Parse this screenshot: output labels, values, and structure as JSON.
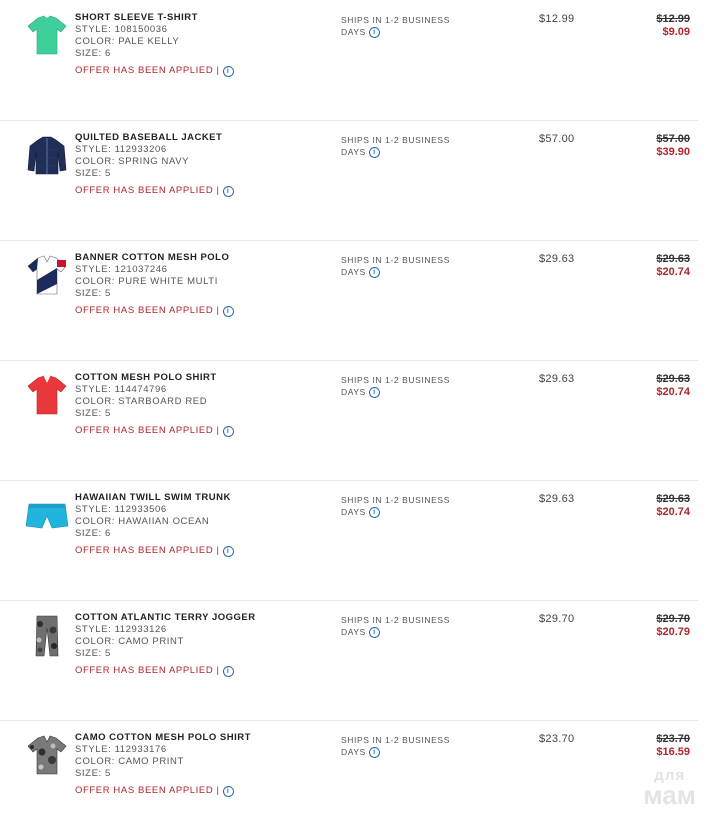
{
  "colors": {
    "accent_red": "#b0262b",
    "info_blue": "#2b6cb0",
    "divider": "#e6e6e6"
  },
  "items": [
    {
      "title": "SHORT SLEEVE T-SHIRT",
      "style": "STYLE:  108150036",
      "color": "COLOR:  PALE KELLY",
      "size": "SIZE:  6",
      "offer": "OFFER HAS BEEN APPLIED |",
      "ship1": "SHIPS IN 1-2 BUSINESS",
      "ship2": "DAYS",
      "price": "$12.99",
      "orig_price": "$12.99",
      "sale_price": "$9.09",
      "icon": "green-tshirt-icon"
    },
    {
      "title": "QUILTED BASEBALL JACKET",
      "style": "STYLE:  112933206",
      "color": "COLOR:  SPRING NAVY",
      "size": "SIZE:  5",
      "offer": "OFFER HAS BEEN APPLIED |",
      "ship1": "SHIPS IN 1-2 BUSINESS",
      "ship2": "DAYS",
      "price": "$57.00",
      "orig_price": "$57.00",
      "sale_price": "$39.90",
      "icon": "navy-jacket-icon"
    },
    {
      "title": "BANNER COTTON MESH POLO",
      "style": "STYLE:  121037246",
      "color": "COLOR:  PURE WHITE MULTI",
      "size": "SIZE:  5",
      "offer": "OFFER HAS BEEN APPLIED |",
      "ship1": "SHIPS IN 1-2 BUSINESS",
      "ship2": "DAYS",
      "price": "$29.63",
      "orig_price": "$29.63",
      "sale_price": "$20.74",
      "icon": "banner-polo-icon"
    },
    {
      "title": "COTTON MESH POLO SHIRT",
      "style": "STYLE:  114474796",
      "color": "COLOR:  STARBOARD RED",
      "size": "SIZE:  5",
      "offer": "OFFER HAS BEEN APPLIED |",
      "ship1": "SHIPS IN 1-2 BUSINESS",
      "ship2": "DAYS",
      "price": "$29.63",
      "orig_price": "$29.63",
      "sale_price": "$20.74",
      "icon": "red-polo-icon"
    },
    {
      "title": "HAWAIIAN TWILL SWIM TRUNK",
      "style": "STYLE:  112933506",
      "color": "COLOR:  HAWAIIAN OCEAN",
      "size": "SIZE:  6",
      "offer": "OFFER HAS BEEN APPLIED |",
      "ship1": "SHIPS IN 1-2 BUSINESS",
      "ship2": "DAYS",
      "price": "$29.63",
      "orig_price": "$29.63",
      "sale_price": "$20.74",
      "icon": "blue-swim-trunk-icon"
    },
    {
      "title": "COTTON ATLANTIC TERRY JOGGER",
      "style": "STYLE:  112933126",
      "color": "COLOR:  CAMO PRINT",
      "size": "SIZE:  5",
      "offer": "OFFER HAS BEEN APPLIED |",
      "ship1": "SHIPS IN 1-2 BUSINESS",
      "ship2": "DAYS",
      "price": "$29.70",
      "orig_price": "$29.70",
      "sale_price": "$20.79",
      "icon": "camo-jogger-icon"
    },
    {
      "title": "CAMO COTTON MESH POLO SHIRT",
      "style": "STYLE:  112933176",
      "color": "COLOR:  CAMO PRINT",
      "size": "SIZE:  5",
      "offer": "OFFER HAS BEEN APPLIED |",
      "ship1": "SHIPS IN 1-2 BUSINESS",
      "ship2": "DAYS",
      "price": "$23.70",
      "orig_price": "$23.70",
      "sale_price": "$16.59",
      "icon": "camo-polo-icon"
    }
  ],
  "info_glyph": "i",
  "watermark": {
    "line1": "для",
    "line2": "мам"
  }
}
